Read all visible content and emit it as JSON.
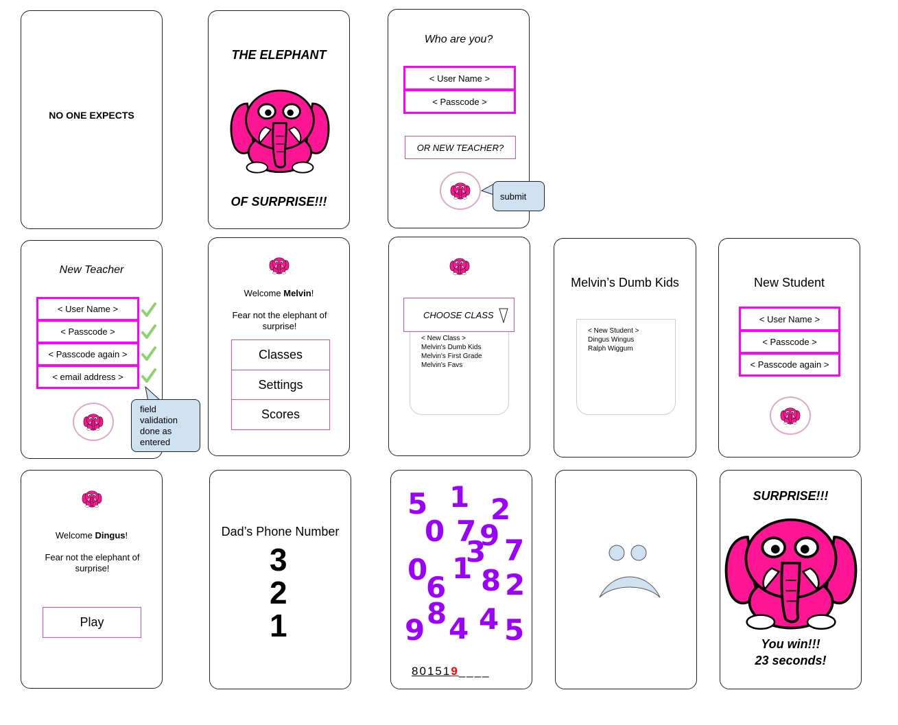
{
  "screen1": {
    "text": "NO ONE EXPECTS"
  },
  "screen2": {
    "title_top": "THE ELEPHANT",
    "title_bottom": "OF SURPRISE!!!"
  },
  "screen3": {
    "prompt": "Who are you?",
    "username_placeholder": "< User Name >",
    "passcode_placeholder": "< Passcode >",
    "new_teacher_label": "OR NEW TEACHER?",
    "submit_note": "submit"
  },
  "screen4": {
    "title": "New Teacher",
    "fields": [
      "< User Name >",
      "< Passcode >",
      "< Passcode again >",
      "< email address >"
    ],
    "validation_note": "field validation done as entered"
  },
  "screen5": {
    "welcome_prefix": "Welcome ",
    "user_name": "Melvin",
    "welcome_suffix": "!",
    "tagline": "Fear not the elephant of surprise!",
    "menu": [
      "Classes",
      "Settings",
      "Scores"
    ]
  },
  "screen6": {
    "dropdown_label": "CHOOSE CLASS",
    "options": [
      "< New Class >",
      "Melvin's Dumb Kids",
      "Melvin's First Grade",
      "Melvin's Favs"
    ]
  },
  "screen7": {
    "title": "Melvin’s Dumb Kids",
    "students": [
      "< New Student >",
      "Dingus Wingus",
      "Ralph Wiggum"
    ]
  },
  "screen8": {
    "title": "New Student",
    "fields": [
      "< User Name >",
      "< Passcode >",
      "< Passcode again >"
    ]
  },
  "screen9": {
    "welcome_prefix": "Welcome ",
    "user_name": "Dingus",
    "welcome_suffix": "!",
    "tagline": "Fear not the elephant of surprise!",
    "play_label": "Play"
  },
  "screen10": {
    "title": "Dad’s Phone Number",
    "countdown": [
      "3",
      "2",
      "1"
    ]
  },
  "screen11": {
    "number_color": "#9b00ff",
    "numbers": [
      "5",
      "1",
      "2",
      "0",
      "7",
      "9",
      "7",
      "3",
      "0",
      "1",
      "8",
      "2",
      "6",
      "9",
      "8",
      "4",
      "4",
      "5"
    ],
    "entered_digits": [
      "8",
      "0",
      "1",
      "5",
      "1"
    ],
    "wrong_digit": "9",
    "blank_slots": 4,
    "wrong_color": "#ff0000"
  },
  "screen12": {
    "face": "sad-face"
  },
  "screen13": {
    "title": "SURPRISE!!!",
    "result_line1": "You win!!!",
    "result_line2": "23 seconds!"
  },
  "colors": {
    "accent_magenta": "#ff00ff",
    "elephant_pink": "#ff1493",
    "note_blue": "#cfe0f1",
    "check_green": "#8cd46a"
  }
}
